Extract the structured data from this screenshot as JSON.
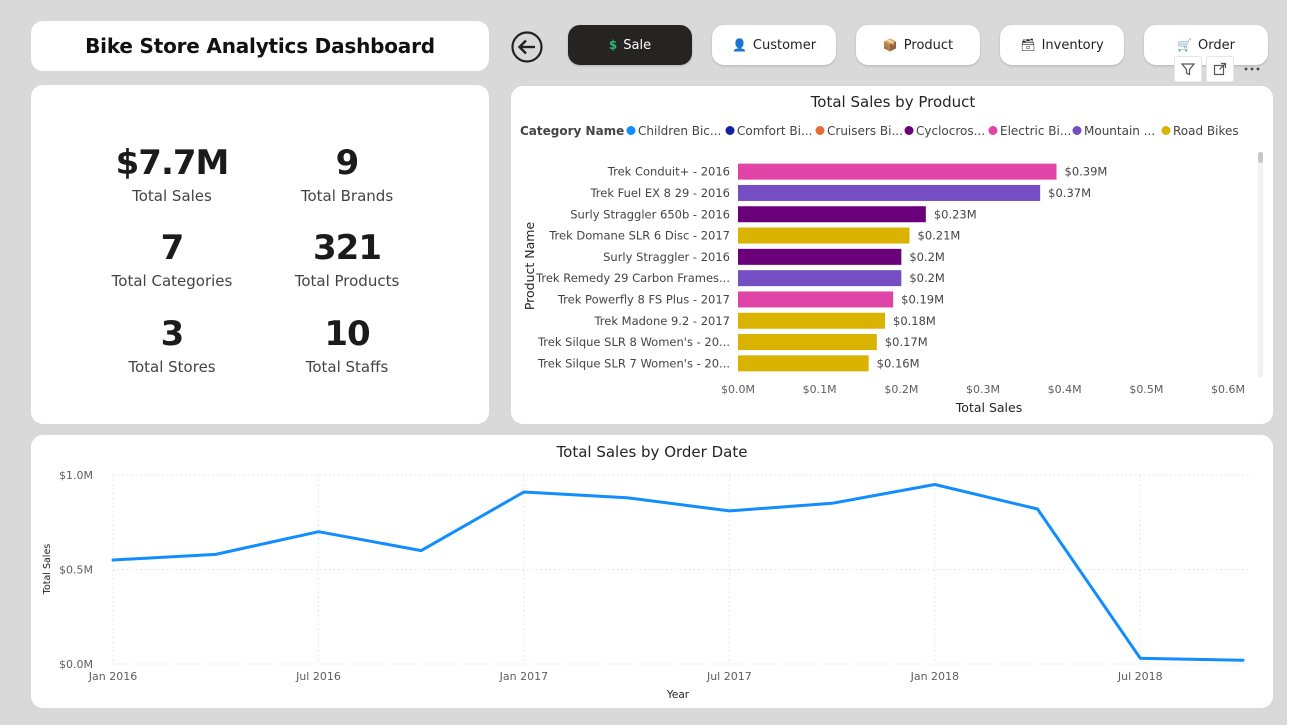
{
  "dashboard": {
    "title": "Bike Store Analytics Dashboard",
    "nav": [
      {
        "label": "Sale",
        "icon": "dollar-icon",
        "glyph": "$",
        "active": true,
        "color": "#2bb673"
      },
      {
        "label": "Customer",
        "icon": "person-icon",
        "glyph": "👤",
        "active": false
      },
      {
        "label": "Product",
        "icon": "box-icon",
        "glyph": "📦",
        "active": false
      },
      {
        "label": "Inventory",
        "icon": "inventory-icon",
        "glyph": "🗃",
        "active": false
      },
      {
        "label": "Order",
        "icon": "cart-icon",
        "glyph": "🛒",
        "active": false
      }
    ],
    "back_icon": "back-arrow-icon"
  },
  "kpis": [
    {
      "value": "$7.7M",
      "label": "Total Sales"
    },
    {
      "value": "9",
      "label": "Total Brands"
    },
    {
      "value": "7",
      "label": "Total Categories"
    },
    {
      "value": "321",
      "label": "Total Products"
    },
    {
      "value": "3",
      "label": "Total Stores"
    },
    {
      "value": "10",
      "label": "Total Staffs"
    }
  ],
  "visual_header_icons": [
    "filter-icon",
    "focus-mode-icon",
    "more-options-icon"
  ],
  "chart_data": [
    {
      "type": "bar",
      "orientation": "horizontal",
      "title": "Total Sales by Product",
      "xlabel": "Total Sales",
      "ylabel": "Product Name",
      "legend_title": "Category Name",
      "legend_position": "top-left",
      "legend": [
        {
          "name": "Children Bic...",
          "color": "#118dff"
        },
        {
          "name": "Comfort Bi...",
          "color": "#12239e"
        },
        {
          "name": "Cruisers Bi...",
          "color": "#e66c37"
        },
        {
          "name": "Cyclocros...",
          "color": "#6b007b"
        },
        {
          "name": "Electric Bi...",
          "color": "#e044a7"
        },
        {
          "name": "Mountain ...",
          "color": "#744ec2"
        },
        {
          "name": "Road Bikes",
          "color": "#d9b300"
        }
      ],
      "categories": [
        "Trek Conduit+ - 2016",
        "Trek Fuel EX 8 29 - 2016",
        "Surly Straggler 650b - 2016",
        "Trek Domane SLR 6 Disc - 2017",
        "Surly Straggler - 2016",
        "Trek Remedy 29 Carbon Frames...",
        "Trek Powerfly 8 FS Plus - 2017",
        "Trek Madone 9.2 - 2017",
        "Trek Silque SLR 8 Women's - 20...",
        "Trek Silque SLR 7 Women's - 20..."
      ],
      "values": [
        0.39,
        0.37,
        0.23,
        0.21,
        0.2,
        0.2,
        0.19,
        0.18,
        0.17,
        0.16
      ],
      "value_labels": [
        "$0.39M",
        "$0.37M",
        "$0.23M",
        "$0.21M",
        "$0.2M",
        "$0.2M",
        "$0.19M",
        "$0.18M",
        "$0.17M",
        "$0.16M"
      ],
      "bar_colors": [
        "#e044a7",
        "#744ec2",
        "#6b007b",
        "#d9b300",
        "#6b007b",
        "#744ec2",
        "#e044a7",
        "#d9b300",
        "#d9b300",
        "#d9b300"
      ],
      "xlim": [
        0,
        0.6
      ],
      "xticks": [
        0,
        0.1,
        0.2,
        0.3,
        0.4,
        0.5,
        0.6
      ],
      "xtick_labels": [
        "$0.0M",
        "$0.1M",
        "$0.2M",
        "$0.3M",
        "$0.4M",
        "$0.5M",
        "$0.6M"
      ],
      "unit": "M"
    },
    {
      "type": "line",
      "title": "Total Sales by Order Date",
      "xlabel": "Year",
      "ylabel": "Total Sales",
      "x": [
        "2016-01",
        "2016-04",
        "2016-07",
        "2016-10",
        "2017-01",
        "2017-04",
        "2017-07",
        "2017-10",
        "2018-01",
        "2018-04",
        "2018-07",
        "2018-10"
      ],
      "series": [
        {
          "values": [
            0.55,
            0.58,
            0.7,
            0.6,
            0.91,
            0.88,
            0.81,
            0.85,
            0.95,
            0.82,
            0.03,
            0.02
          ],
          "color": "#118dff"
        }
      ],
      "ylim": [
        0,
        1.0
      ],
      "yticks": [
        0,
        0.5,
        1.0
      ],
      "ytick_labels": [
        "$0.0M",
        "$0.5M",
        "$1.0M"
      ],
      "xtick_labels": [
        "Jan 2016",
        "Jul 2016",
        "Jan 2017",
        "Jul 2017",
        "Jan 2018",
        "Jul 2018"
      ],
      "grid": true
    }
  ]
}
